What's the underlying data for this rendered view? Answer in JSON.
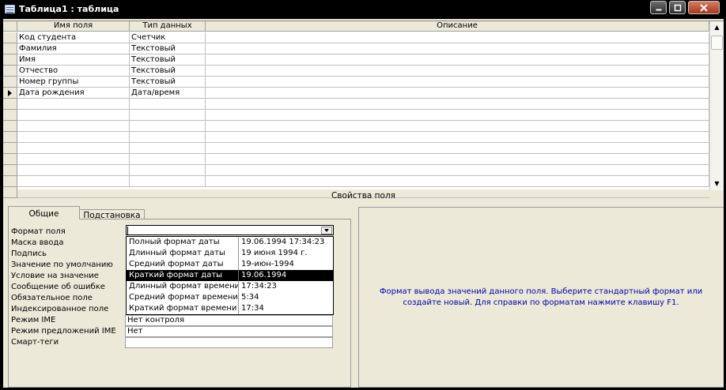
{
  "window": {
    "title": "Таблица1 : таблица",
    "minimize": "minimize",
    "maximize": "maximize",
    "close": "close"
  },
  "grid": {
    "headers": [
      "Имя поля",
      "Тип данных",
      "Описание"
    ],
    "rows": [
      {
        "name": "Код студента",
        "type": "Счетчик",
        "desc": ""
      },
      {
        "name": "Фамилия",
        "type": "Текстовый",
        "desc": ""
      },
      {
        "name": "Имя",
        "type": "Текстовый",
        "desc": ""
      },
      {
        "name": "Отчество",
        "type": "Текстовый",
        "desc": ""
      },
      {
        "name": "Номер группы",
        "type": "Текстовый",
        "desc": ""
      },
      {
        "name": "Дата рождения",
        "type": "Дата/время",
        "desc": ""
      },
      {
        "name": "",
        "type": "",
        "desc": ""
      },
      {
        "name": "",
        "type": "",
        "desc": ""
      },
      {
        "name": "",
        "type": "",
        "desc": ""
      },
      {
        "name": "",
        "type": "",
        "desc": ""
      },
      {
        "name": "",
        "type": "",
        "desc": ""
      },
      {
        "name": "",
        "type": "",
        "desc": ""
      },
      {
        "name": "",
        "type": "",
        "desc": ""
      },
      {
        "name": "",
        "type": "",
        "desc": ""
      }
    ],
    "current_row": 5
  },
  "properties": {
    "title": "Свойства поля",
    "tabs": [
      "Общие",
      "Подстановка"
    ],
    "labels": [
      "Формат поля",
      "Маска ввода",
      "Подпись",
      "Значение по умолчанию",
      "Условие на значение",
      "Сообщение об ошибке",
      "Обязательное поле",
      "Индексированное поле",
      "Режим IME",
      "Режим предложений IME",
      "Смарт-теги"
    ],
    "ime_mode": "Нет контроля",
    "ime_sentence": "Нет",
    "format_value": "",
    "format_options": [
      {
        "name": "Полный формат даты",
        "example": "19.06.1994 17:34:23"
      },
      {
        "name": "Длинный формат даты",
        "example": "19 июня 1994 г."
      },
      {
        "name": "Средний формат даты",
        "example": "19-июн-1994"
      },
      {
        "name": "Краткий формат даты",
        "example": "19.06.1994"
      },
      {
        "name": "Длинный формат времени",
        "example": "17:34:23"
      },
      {
        "name": "Средний формат времени",
        "example": "5:34"
      },
      {
        "name": "Краткий формат времени",
        "example": "17:34"
      }
    ],
    "highlighted_option": 3
  },
  "help": {
    "text": "Формат вывода значений данного поля.  Выберите стандартный формат или создайте новый.  Для справки по форматам нажмите клавишу F1."
  },
  "colors": {
    "titlebar": "#000000",
    "client": "#ece9d8",
    "help_text": "#0000aa",
    "highlight": "#000000"
  }
}
